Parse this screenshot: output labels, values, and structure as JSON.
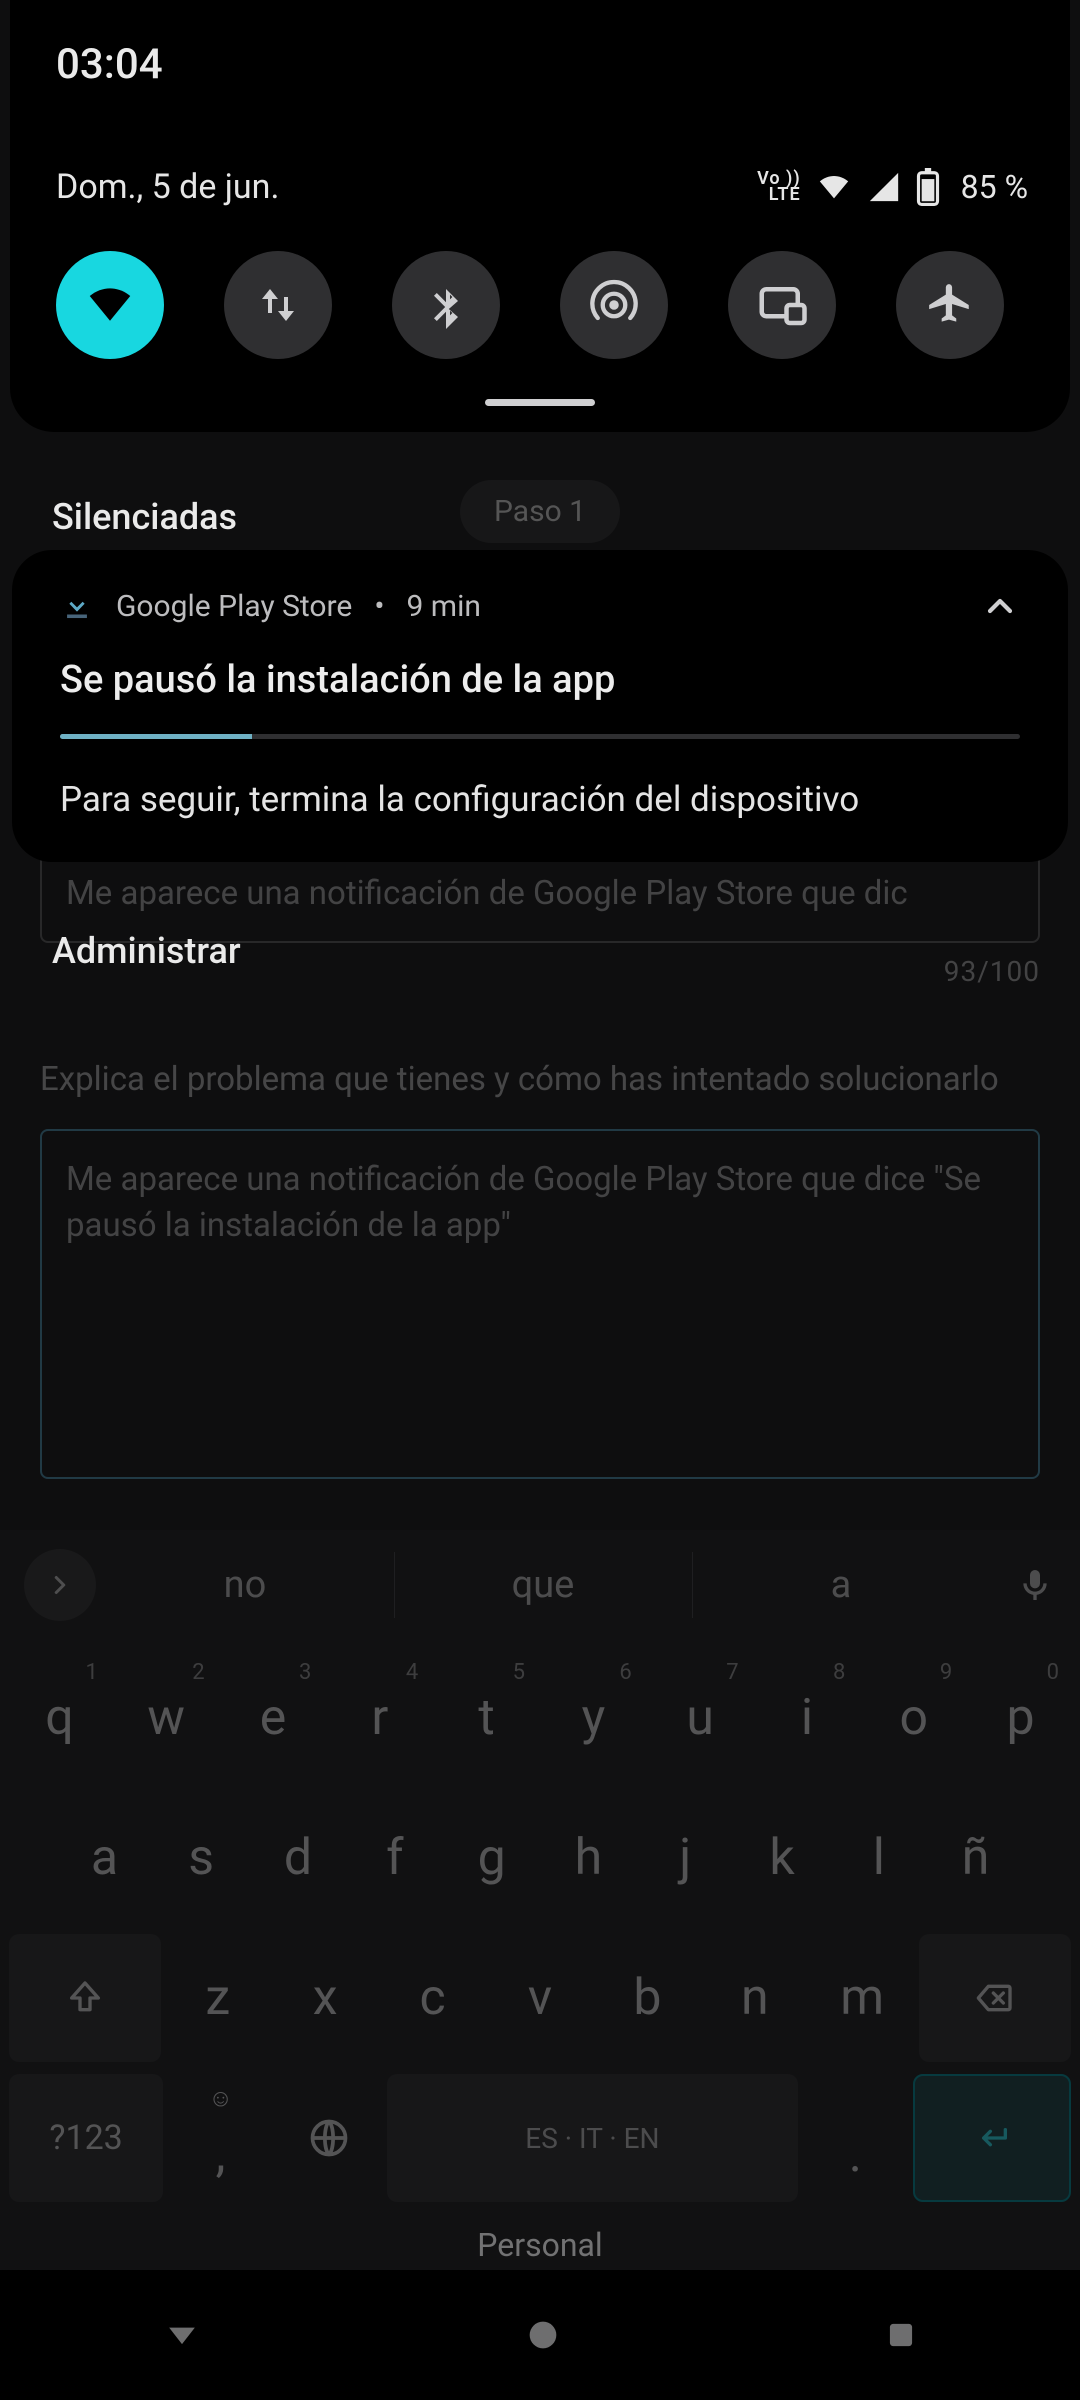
{
  "status_bar": {
    "clock": "03:04",
    "date": "Dom., 5 de jun.",
    "battery_pct": "85 %",
    "volte_top": "Vo ))",
    "volte_bot": "LTE"
  },
  "quick_settings": {
    "wifi": {
      "name": "wifi-icon",
      "on": true
    },
    "data": {
      "name": "data-icon",
      "on": false
    },
    "bt": {
      "name": "bluetooth-icon",
      "on": false
    },
    "hotspot": {
      "name": "hotspot-icon",
      "on": false
    },
    "cast": {
      "name": "cast-icon",
      "on": false
    },
    "airplane": {
      "name": "airplane-icon",
      "on": false
    }
  },
  "shade": {
    "silenced_label": "Silenciadas",
    "manage_label": "Administrar"
  },
  "notification": {
    "app": "Google Play Store",
    "time": "9 min",
    "title": "Se pausó la instalación de la app",
    "progress_pct": 20,
    "message": "Para seguir, termina la configuración del dispositivo"
  },
  "background_form": {
    "step_chip": "Paso 1",
    "title_peek": "Me aparece una notificación de Google Play Store que dic",
    "counter": "93/100",
    "explain_label": "Explica el problema que tienes y cómo has intentado solucionarlo",
    "textarea_value": "Me aparece una notificación de Google Play Store que dice \"Se pausó la instalación de la app\""
  },
  "keyboard": {
    "suggestions": [
      "no",
      "que",
      "a"
    ],
    "row1": [
      {
        "k": "q",
        "h": "1"
      },
      {
        "k": "w",
        "h": "2"
      },
      {
        "k": "e",
        "h": "3"
      },
      {
        "k": "r",
        "h": "4"
      },
      {
        "k": "t",
        "h": "5"
      },
      {
        "k": "y",
        "h": "6"
      },
      {
        "k": "u",
        "h": "7"
      },
      {
        "k": "i",
        "h": "8"
      },
      {
        "k": "o",
        "h": "9"
      },
      {
        "k": "p",
        "h": "0"
      }
    ],
    "row2": [
      "a",
      "s",
      "d",
      "f",
      "g",
      "h",
      "j",
      "k",
      "l",
      "ñ"
    ],
    "row3_letters": [
      "z",
      "x",
      "c",
      "v",
      "b",
      "n",
      "m"
    ],
    "sym_label": "?123",
    "space_label": "ES · IT · EN",
    "brand": "Personal"
  }
}
